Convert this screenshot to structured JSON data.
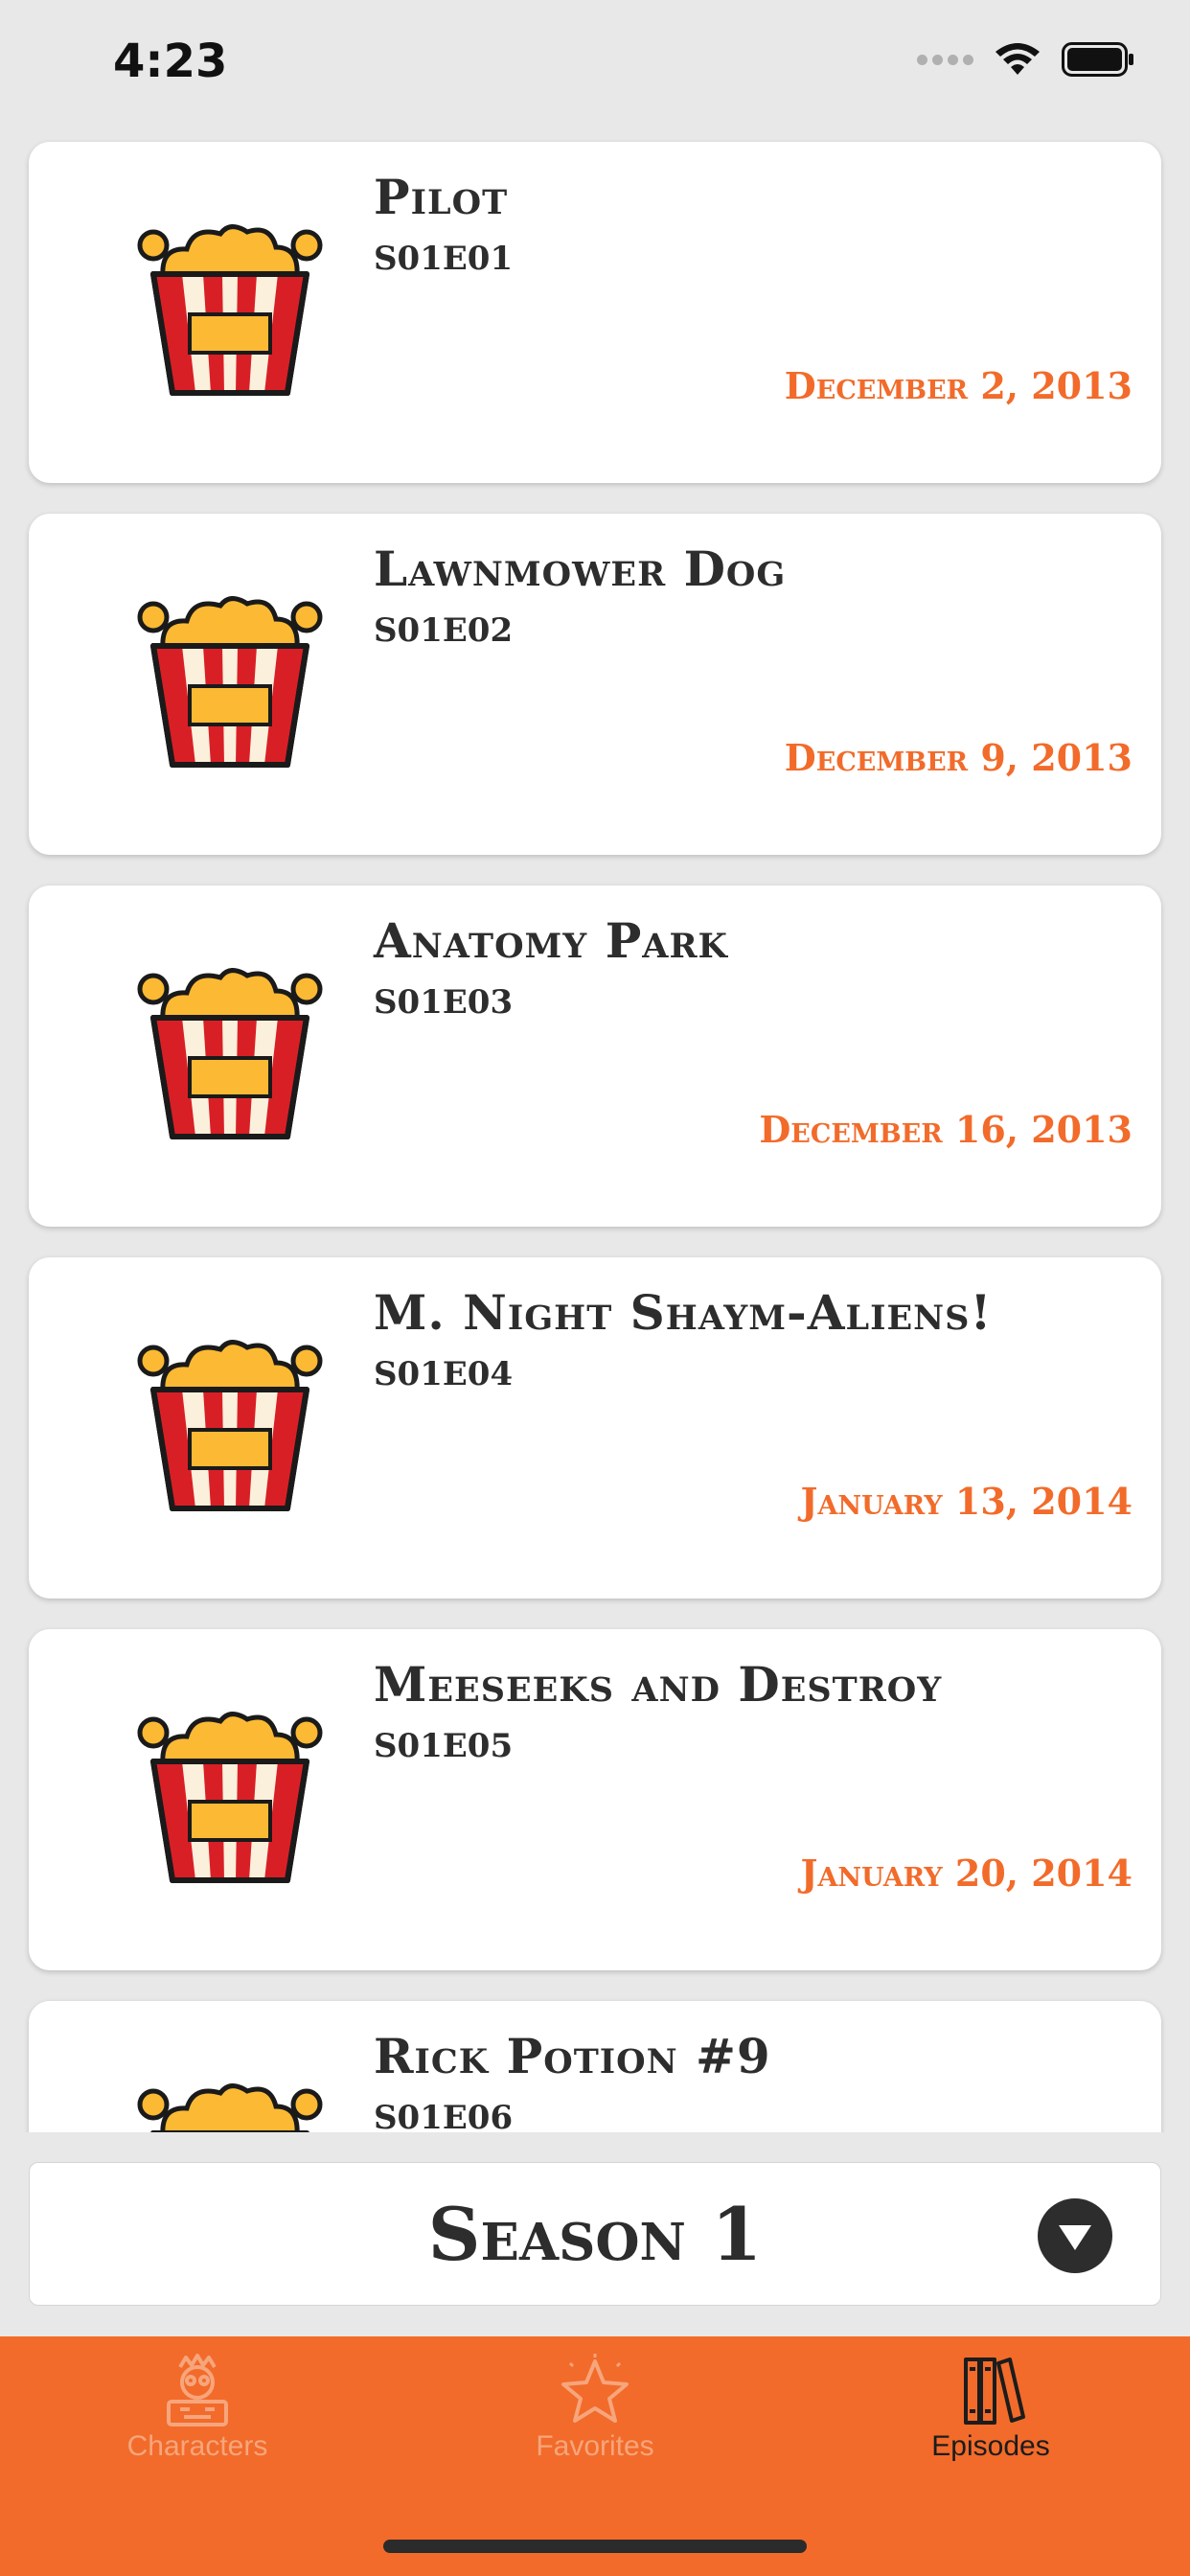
{
  "status_bar": {
    "time": "4:23"
  },
  "episodes": [
    {
      "title": "Pilot",
      "code": "S01E01",
      "air_date": "December 2, 2013",
      "icon": "popcorn-icon"
    },
    {
      "title": "Lawnmower Dog",
      "code": "S01E02",
      "air_date": "December 9, 2013",
      "icon": "popcorn-icon"
    },
    {
      "title": "Anatomy Park",
      "code": "S01E03",
      "air_date": "December 16, 2013",
      "icon": "popcorn-icon"
    },
    {
      "title": "M. Night Shaym-Aliens!",
      "code": "S01E04",
      "air_date": "January 13, 2014",
      "icon": "popcorn-icon"
    },
    {
      "title": "Meeseeks and Destroy",
      "code": "S01E05",
      "air_date": "January 20, 2014",
      "icon": "popcorn-icon"
    },
    {
      "title": "Rick Potion #9",
      "code": "S01E06",
      "air_date": "",
      "icon": "popcorn-icon"
    }
  ],
  "season_selector": {
    "label": "Season 1",
    "icon": "chevron-down-icon"
  },
  "tab_bar": {
    "tabs": [
      {
        "label": "Characters",
        "icon": "character-icon",
        "selected": false
      },
      {
        "label": "Favorites",
        "icon": "star-icon",
        "selected": false
      },
      {
        "label": "Episodes",
        "icon": "books-icon",
        "selected": true
      }
    ]
  },
  "colors": {
    "accent": "#f26b2a",
    "background": "#e8e8e8",
    "card": "#ffffff",
    "text_dark": "#2d2d2d",
    "tab_inactive": "#f7a57c"
  }
}
